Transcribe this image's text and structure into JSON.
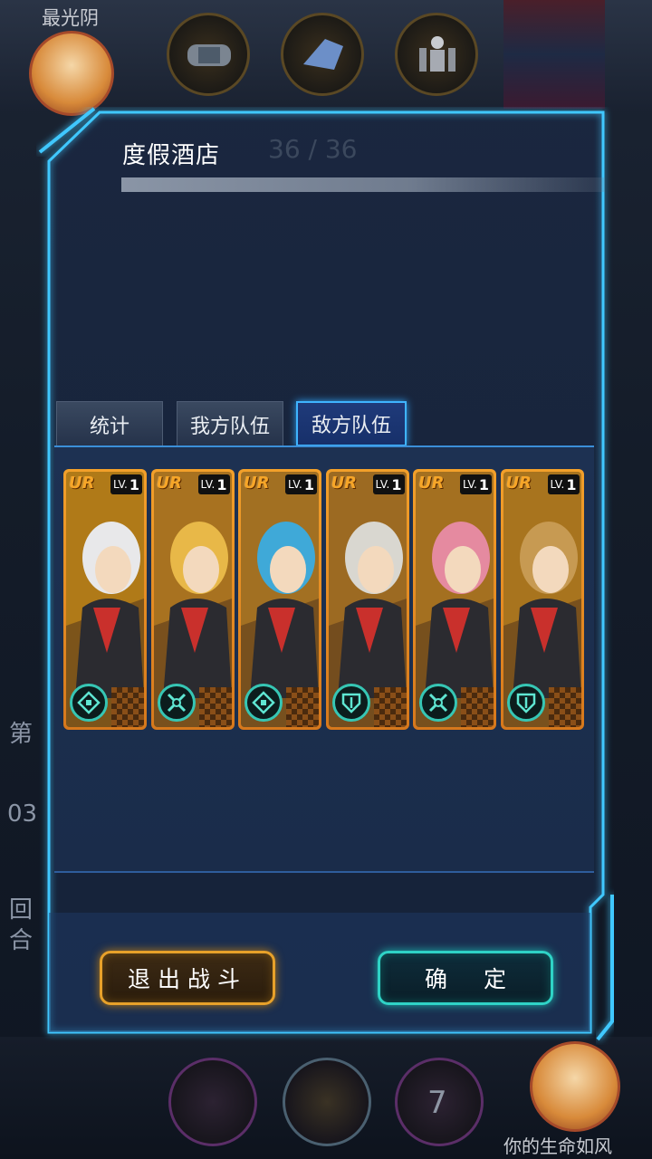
{
  "background": {
    "player_name": "最光阴",
    "side_label_1": "第",
    "side_label_2": "03",
    "side_label_3": "回",
    "side_label_4": "合",
    "turn_number": "7",
    "opponent_name": "你的生命如风"
  },
  "dialog": {
    "title": "度假酒店",
    "ghost_count": "36 / 36",
    "tabs": [
      {
        "label": "统计",
        "active": false
      },
      {
        "label": "我方队伍",
        "active": false
      },
      {
        "label": "敌方队伍",
        "active": true
      }
    ],
    "cards": [
      {
        "rank": "UR",
        "lv_prefix": "LV.",
        "level": "1",
        "badge_icon": "diamond-arrows-icon",
        "hair": "#e8e8ea",
        "bg": "#b07a18"
      },
      {
        "rank": "UR",
        "lv_prefix": "LV.",
        "level": "1",
        "badge_icon": "cross-blades-icon",
        "hair": "#e8b848",
        "bg": "#a87220"
      },
      {
        "rank": "UR",
        "lv_prefix": "LV.",
        "level": "1",
        "badge_icon": "diamond-arrows-icon",
        "hair": "#3fa9d8",
        "bg": "#a27022"
      },
      {
        "rank": "UR",
        "lv_prefix": "LV.",
        "level": "1",
        "badge_icon": "shield-sword-icon",
        "hair": "#d9d7d0",
        "bg": "#9c6a22"
      },
      {
        "rank": "UR",
        "lv_prefix": "LV.",
        "level": "1",
        "badge_icon": "cross-blades-icon",
        "hair": "#e58aa0",
        "bg": "#a47020"
      },
      {
        "rank": "UR",
        "lv_prefix": "LV.",
        "level": "1",
        "badge_icon": "shield-sword-icon",
        "hair": "#c79a52",
        "bg": "#a8741e"
      }
    ],
    "exit_button": "退出战斗",
    "confirm_button": "确定"
  },
  "colors": {
    "frame": "#3fc8ff",
    "tab_active": "#3fb4ff",
    "card_border": "#f3a02a",
    "exit_border": "#e7a12a",
    "ok_border": "#2fd3c6"
  }
}
